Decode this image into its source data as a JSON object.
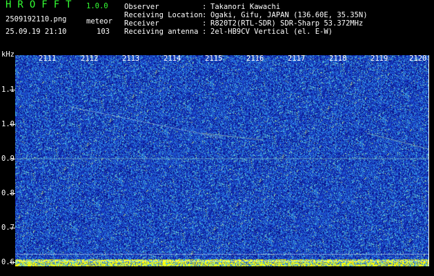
{
  "header": {
    "app_title": "HROFFT",
    "version": "1.0.0",
    "filename": "2509192110.png",
    "obs_type": "meteor",
    "datetime": "25.09.19 21:10",
    "count": "103"
  },
  "meta": [
    {
      "label": "Observer",
      "value": "Takanori Kawachi"
    },
    {
      "label": "Receiving Location",
      "value": "Ogaki, Gifu, JAPAN (136.60E, 35.35N)"
    },
    {
      "label": "Receiver",
      "value": "R820T2(RTL-SDR) SDR-Sharp 53.372MHz"
    },
    {
      "label": "Receiving antenna",
      "value": "2el-HB9CV Vertical (el. E-W)"
    }
  ],
  "axis": {
    "unit": "kHz",
    "y_ticks": [
      "1.1",
      "1.0",
      "0.9",
      "0.8",
      "0.7",
      "0.6"
    ],
    "x_ticks": [
      "2111",
      "2112",
      "2113",
      "2114",
      "2115",
      "2116",
      "2117",
      "2118",
      "2119",
      "2120"
    ]
  },
  "colors": {
    "background": "#000000",
    "title_green": "#33ff33",
    "spectrum_base": "#1a3fc0",
    "noise_floor": "#ffff00"
  }
}
